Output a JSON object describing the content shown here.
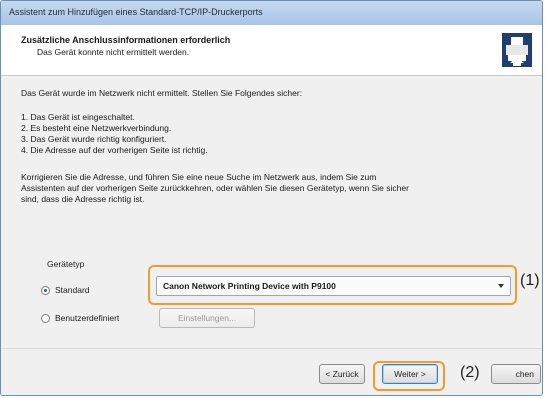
{
  "window": {
    "title": "Assistent zum Hinzufügen eines Standard-TCP/IP-Druckerports"
  },
  "header": {
    "title": "Zusätzliche Anschlussinformationen erforderlich",
    "subtitle": "Das Gerät konnte nicht ermittelt werden.",
    "icon": "printer-icon"
  },
  "content": {
    "intro": "Das Gerät wurde im Netzwerk nicht ermittelt. Stellen Sie Folgendes sicher:",
    "checklist": [
      "1.  Das Gerät ist eingeschaltet.",
      "2.  Es besteht eine Netzwerkverbindung.",
      "3.  Das Gerät wurde richtig konfiguriert.",
      "4.  Die Adresse auf der vorherigen Seite ist richtig."
    ],
    "instructions": [
      "Korrigieren Sie die Adresse, und führen Sie eine neue Suche im Netzwerk aus, indem Sie zum",
      "Assistenten auf der vorherigen Seite zurückkehren, oder wählen Sie diesen Gerätetyp, wenn Sie sicher",
      "sind, dass die Adresse richtig ist."
    ]
  },
  "device_type": {
    "group_label": "Gerätetyp",
    "standard_label": "Standard",
    "custom_label": "Benutzerdefiniert",
    "selected_option": "standard",
    "selected_device": "Canon Network Printing Device with P9100",
    "settings_button": "Einstellungen..."
  },
  "footer": {
    "back_button": "< Zurück",
    "next_button": "Weiter >",
    "cancel_button_partial": "chen"
  },
  "callouts": {
    "one": "(1)",
    "two": "(2)",
    "highlight_color": "#f39b2e"
  }
}
